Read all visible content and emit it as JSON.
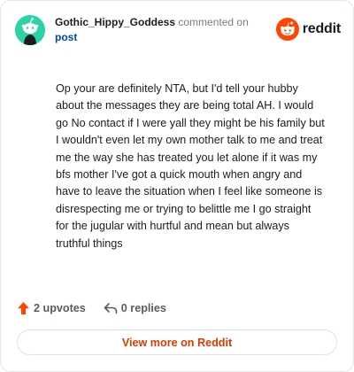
{
  "comment": {
    "author": "Gothic_Hippy_Goddess",
    "action_text": "commented on",
    "post_link": "post",
    "body": "Op your are definitely NTA, but I'd tell your hubby about the messages they are being total AH. I would go No contact if I were yall they might be his family but I wouldn't even let my own mother talk to me and treat me the way she has treated you let alone if it was my bfs mother I've got a quick mouth when angry and have to leave the situation when I feel like someone is disrespecting me or trying to belittle me I go straight for the jugular with hurtful and mean but always truthful things"
  },
  "brand": {
    "logo_text": "reddit",
    "accent_color": "#ff4500",
    "avatar_color": "#2bd3a6"
  },
  "actions": {
    "upvotes_label": "2 upvotes",
    "replies_label": "0 replies"
  },
  "cta": {
    "view_more_label": "View more on Reddit"
  },
  "icons": [
    "avatar-snoo-icon",
    "reddit-logo-icon",
    "upvote-arrow-icon",
    "reply-arrow-icon"
  ]
}
